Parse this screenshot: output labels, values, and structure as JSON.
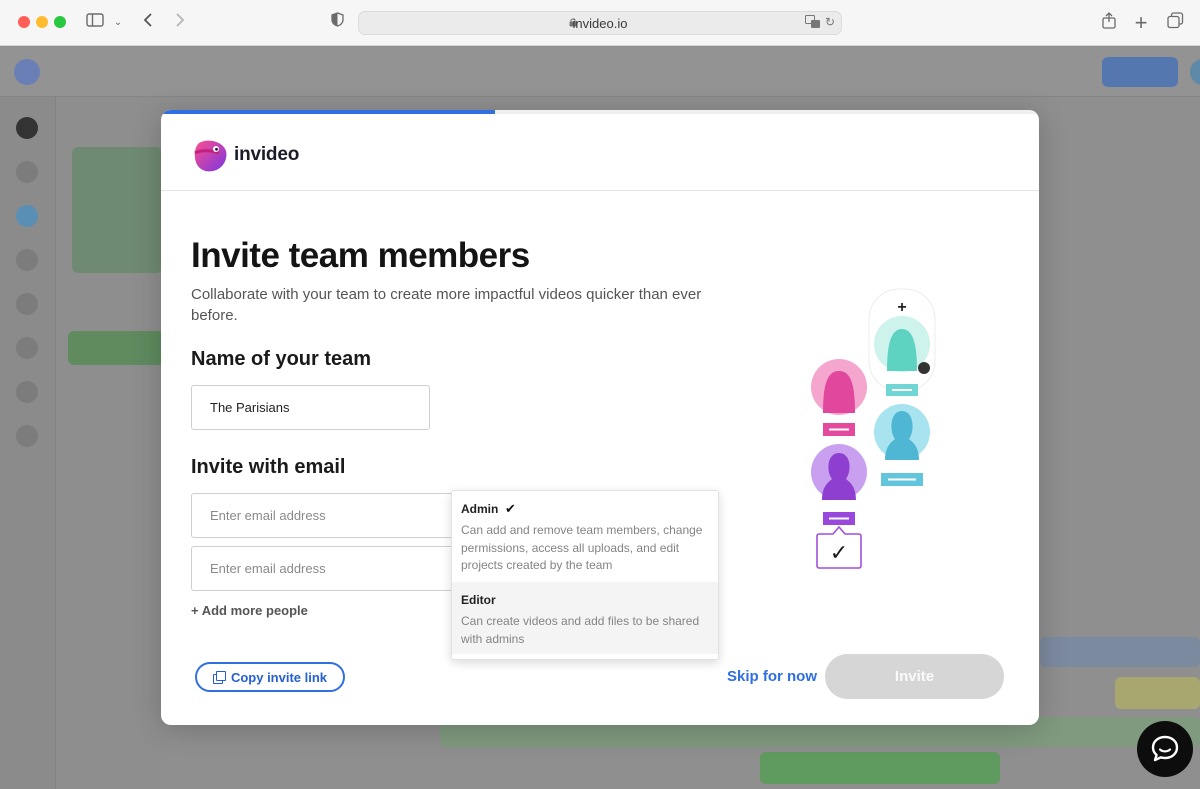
{
  "browser": {
    "url": "invideo.io",
    "icons": [
      "sidebar-icon",
      "chevron-down-icon",
      "back-icon",
      "forward-icon",
      "shield-icon",
      "lock-icon",
      "translate-icon",
      "reload-icon",
      "share-icon",
      "new-tab-icon",
      "tabs-overview-icon"
    ]
  },
  "modal": {
    "progress": 0.38,
    "brand": "invideo",
    "title": "Invite team members",
    "subtitle": "Collaborate with your team to create more impactful videos quicker than ever before.",
    "team_section": {
      "heading": "Name of your team",
      "value": "The Parisians"
    },
    "email_section": {
      "heading": "Invite with email",
      "fields": [
        {
          "placeholder": "Enter email address",
          "value": ""
        },
        {
          "placeholder": "Enter email address",
          "value": ""
        }
      ],
      "add_more": "+ Add more people"
    },
    "role_dropdown": {
      "options": [
        {
          "title": "Admin",
          "selected": true,
          "description": "Can add and remove team members, change permissions, access all uploads, and edit projects created by the team"
        },
        {
          "title": "Editor",
          "selected": false,
          "description": "Can create videos and add files to be shared with admins"
        }
      ],
      "check_mark": "✔"
    },
    "copy_link_label": "Copy invite link",
    "skip_label": "Skip for now",
    "invite_label": "Invite",
    "illustration": {
      "plus": "+",
      "check": "✓"
    }
  },
  "colors": {
    "accent": "#2f6fe0",
    "invite_disabled": "#d6d6d6",
    "avatar_pink": "#ef5aa8",
    "avatar_teal": "#5fd3c2",
    "avatar_blue": "#5cc6e0",
    "avatar_purple": "#a45ee5"
  }
}
